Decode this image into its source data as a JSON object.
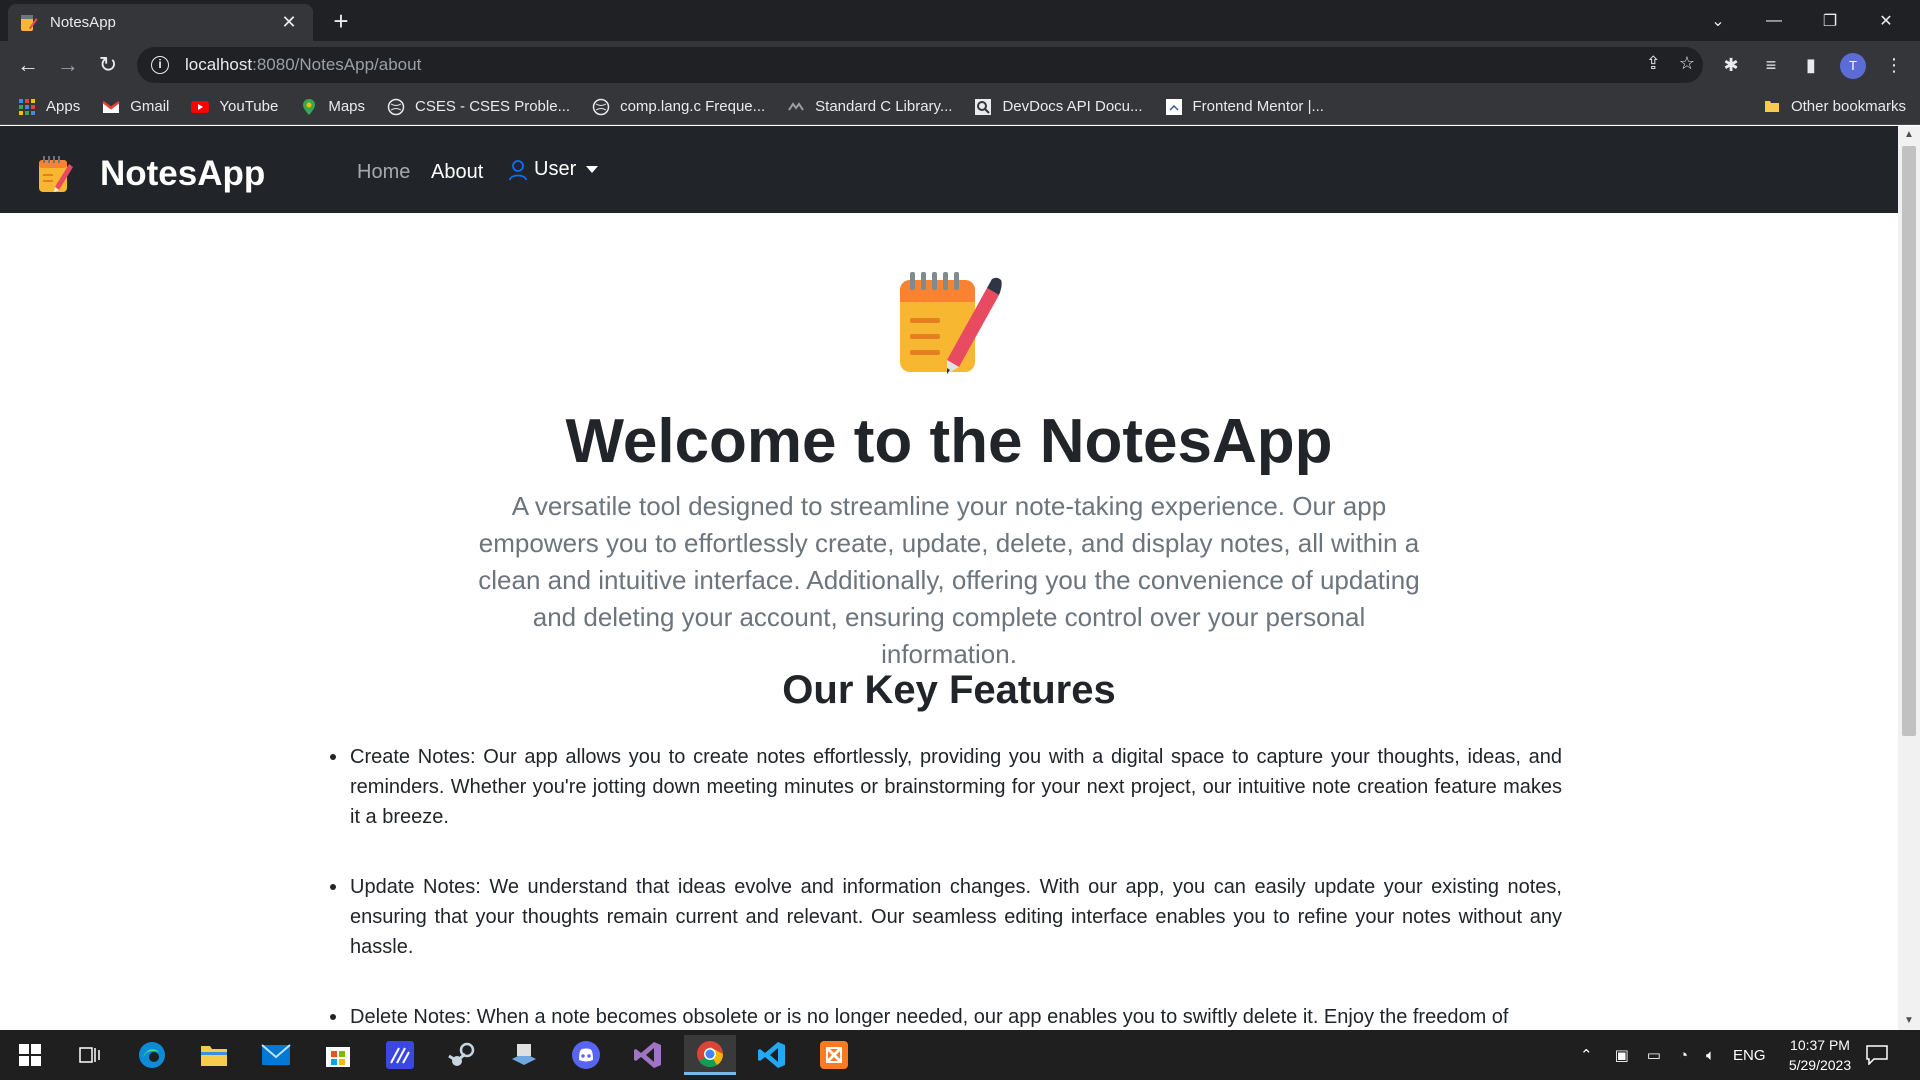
{
  "browser": {
    "tab_title": "NotesApp",
    "url_host": "localhost",
    "url_rest": ":8080/NotesApp/about",
    "bookmarks": [
      {
        "label": "Apps",
        "icon": "apps-grid-icon"
      },
      {
        "label": "Gmail",
        "icon": "gmail-icon"
      },
      {
        "label": "YouTube",
        "icon": "youtube-icon"
      },
      {
        "label": "Maps",
        "icon": "maps-icon"
      },
      {
        "label": "CSES - CSES Proble...",
        "icon": "globe-icon"
      },
      {
        "label": "comp.lang.c Freque...",
        "icon": "globe-icon"
      },
      {
        "label": "Standard C Library...",
        "icon": "c-library-icon"
      },
      {
        "label": "DevDocs API Docu...",
        "icon": "devdocs-icon"
      },
      {
        "label": "Frontend Mentor |...",
        "icon": "frontend-mentor-icon"
      }
    ],
    "other_bookmarks": "Other bookmarks",
    "profile_initial": "T"
  },
  "navbar": {
    "brand": "NotesApp",
    "home": "Home",
    "about": "About",
    "user": "User"
  },
  "hero": {
    "title": "Welcome to the NotesApp",
    "description": "A versatile tool designed to streamline your note-taking experience. Our app empowers you to effortlessly create, update, delete, and display notes, all within a clean and intuitive interface. Additionally, offering you the convenience of updating and deleting your account, ensuring complete control over your personal information."
  },
  "features": {
    "title": "Our Key Features",
    "items": [
      "Create Notes: Our app allows you to create notes effortlessly, providing you with a digital space to capture your thoughts, ideas, and reminders. Whether you're jotting down meeting minutes or brainstorming for your next project, our intuitive note creation feature makes it a breeze.",
      "Update Notes: We understand that ideas evolve and information changes. With our app, you can easily update your existing notes, ensuring that your thoughts remain current and relevant. Our seamless editing interface enables you to refine your notes without any hassle.",
      "Delete Notes: When a note becomes obsolete or is no longer needed, our app enables you to swiftly delete it. Enjoy the freedom of"
    ]
  },
  "taskbar": {
    "language": "ENG",
    "time": "10:37 PM",
    "date": "5/29/2023"
  },
  "colors": {
    "navbar_bg": "#212529",
    "text_dark": "#212529",
    "text_muted": "#6c757d"
  }
}
